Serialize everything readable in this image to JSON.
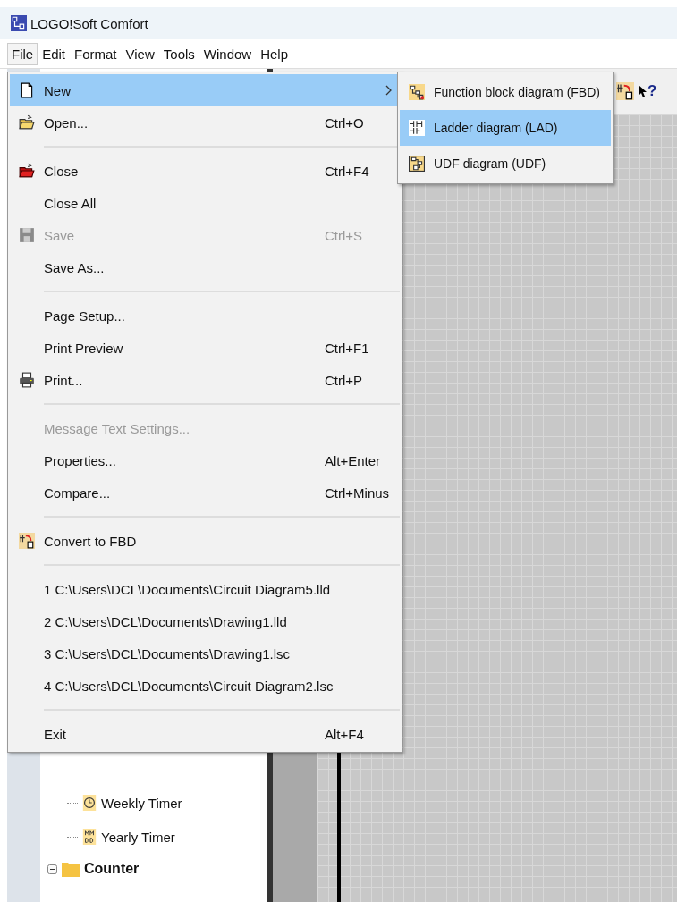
{
  "window": {
    "title": "LOGO!Soft Comfort"
  },
  "menubar": [
    {
      "label": "File",
      "selected": true
    },
    {
      "label": "Edit",
      "selected": false
    },
    {
      "label": "Format",
      "selected": false
    },
    {
      "label": "View",
      "selected": false
    },
    {
      "label": "Tools",
      "selected": false
    },
    {
      "label": "Window",
      "selected": false
    },
    {
      "label": "Help",
      "selected": false
    }
  ],
  "file_menu": [
    {
      "kind": "item",
      "label": "New",
      "submenu": true,
      "selected": true,
      "disabled": false
    },
    {
      "kind": "item",
      "label": "Open...",
      "shortcut": "Ctrl+O",
      "selected": false,
      "disabled": false
    },
    {
      "kind": "separator"
    },
    {
      "kind": "item",
      "label": "Close",
      "shortcut": "Ctrl+F4",
      "selected": false,
      "disabled": false
    },
    {
      "kind": "item",
      "label": "Close All",
      "selected": false,
      "disabled": false
    },
    {
      "kind": "item",
      "label": "Save",
      "shortcut": "Ctrl+S",
      "selected": false,
      "disabled": true
    },
    {
      "kind": "item",
      "label": "Save As...",
      "selected": false,
      "disabled": false
    },
    {
      "kind": "separator"
    },
    {
      "kind": "item",
      "label": "Page Setup...",
      "selected": false,
      "disabled": false
    },
    {
      "kind": "item",
      "label": "Print Preview",
      "shortcut": "Ctrl+F1",
      "selected": false,
      "disabled": false
    },
    {
      "kind": "item",
      "label": "Print...",
      "shortcut": "Ctrl+P",
      "selected": false,
      "disabled": false
    },
    {
      "kind": "separator"
    },
    {
      "kind": "item",
      "label": "Message Text Settings...",
      "selected": false,
      "disabled": true
    },
    {
      "kind": "item",
      "label": "Properties...",
      "shortcut": "Alt+Enter",
      "selected": false,
      "disabled": false
    },
    {
      "kind": "item",
      "label": "Compare...",
      "shortcut": "Ctrl+Minus",
      "selected": false,
      "disabled": false
    },
    {
      "kind": "separator"
    },
    {
      "kind": "item",
      "label": "Convert to FBD",
      "selected": false,
      "disabled": false
    },
    {
      "kind": "separator"
    },
    {
      "kind": "item",
      "label": "1 C:\\Users\\DCL\\Documents\\Circuit Diagram5.lld",
      "selected": false,
      "disabled": false
    },
    {
      "kind": "item",
      "label": "2 C:\\Users\\DCL\\Documents\\Drawing1.lld",
      "selected": false,
      "disabled": false
    },
    {
      "kind": "item",
      "label": "3 C:\\Users\\DCL\\Documents\\Drawing1.lsc",
      "selected": false,
      "disabled": false
    },
    {
      "kind": "item",
      "label": "4 C:\\Users\\DCL\\Documents\\Circuit Diagram2.lsc",
      "selected": false,
      "disabled": false
    },
    {
      "kind": "separator"
    },
    {
      "kind": "item",
      "label": "Exit",
      "shortcut": "Alt+F4",
      "selected": false,
      "disabled": false
    }
  ],
  "new_submenu": [
    {
      "label": "Function block diagram (FBD)",
      "selected": false
    },
    {
      "label": "Ladder diagram (LAD)",
      "selected": true
    },
    {
      "label": "UDF diagram (UDF)",
      "selected": false
    }
  ],
  "toolbar": [
    {
      "kind": "convert"
    },
    {
      "kind": "help",
      "label": "?"
    }
  ],
  "tree": [
    {
      "kind": "block",
      "label": "Weekly Timer"
    },
    {
      "kind": "block",
      "label": "Yearly Timer"
    },
    {
      "kind": "folder",
      "label": "Counter",
      "expanded": true
    }
  ]
}
